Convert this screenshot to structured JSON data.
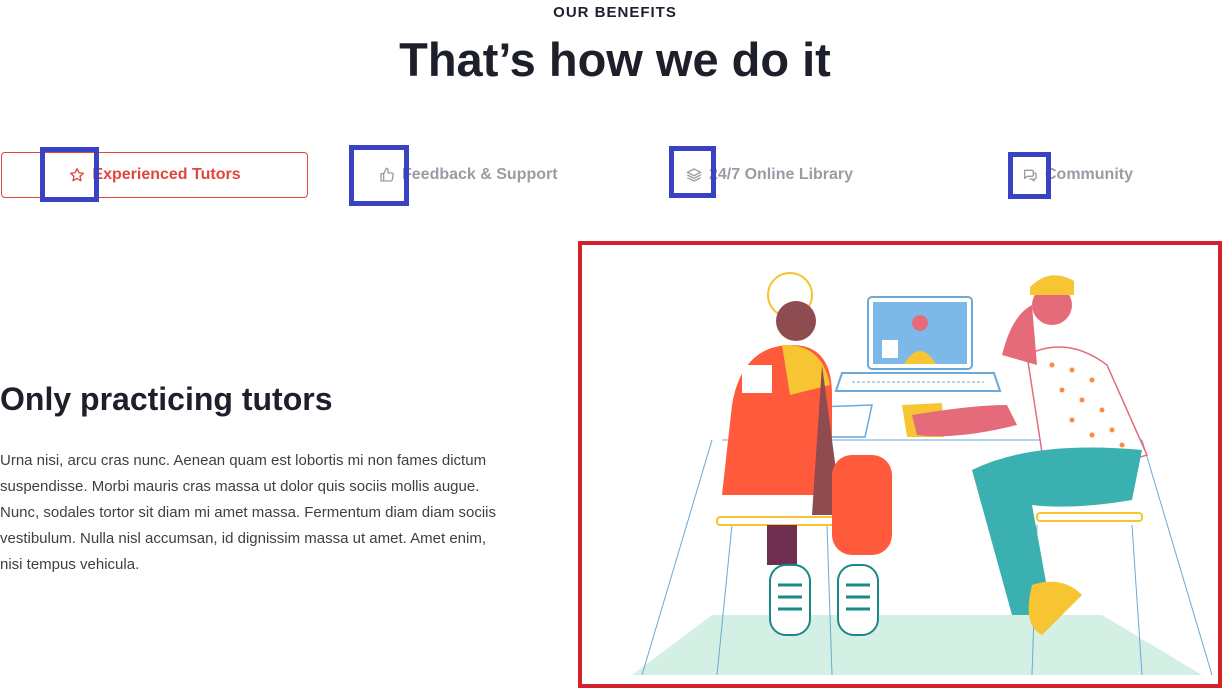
{
  "header": {
    "eyebrow": "OUR BENEFITS",
    "title": "That’s how we do it"
  },
  "tabs": [
    {
      "label": "Experienced Tutors",
      "icon": "star-icon",
      "active": true
    },
    {
      "label": "Feedback & Support",
      "icon": "thumbs-up-icon",
      "active": false
    },
    {
      "label": "24/7 Online Library",
      "icon": "layers-icon",
      "active": false
    },
    {
      "label": "Community",
      "icon": "chat-bubbles-icon",
      "active": false
    }
  ],
  "content": {
    "heading": "Only practicing tutors",
    "body": "Urna nisi, arcu cras nunc. Aenean quam est lobortis mi non fames dictum suspendisse. Morbi mauris cras massa ut dolor quis sociis mollis augue. Nunc, sodales tortor sit diam mi amet massa. Fermentum diam diam sociis vestibulum. Nulla nisl accumsan, id dignissim massa ut amet. Amet enim, nisi tempus vehicula."
  },
  "illustration": {
    "subject": "tutoring-session-illustration"
  },
  "colors": {
    "accent": "#e0463c",
    "heading": "#1d1f2b",
    "muted": "#9a9ca5",
    "highlight_box": "#3a42c4",
    "frame": "#d2232a"
  }
}
